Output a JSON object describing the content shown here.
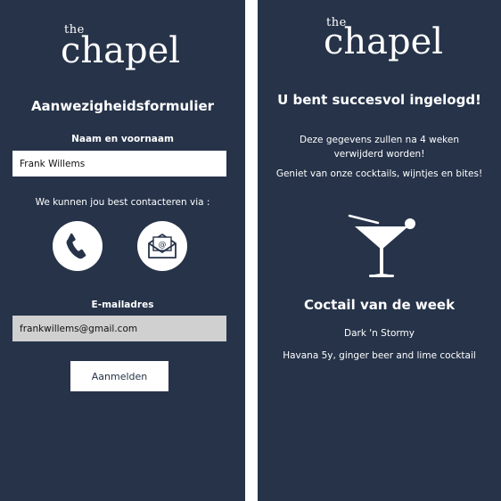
{
  "login_screen": {
    "logo": {
      "small": "the",
      "main": "chapel"
    },
    "title": "Aanwezigheidsformulier",
    "name_label": "Naam en voornaam",
    "name_value": "Frank Willems",
    "contact_prompt": "We kunnen jou best contacteren via :",
    "contact_options": [
      {
        "icon": "phone-icon"
      },
      {
        "icon": "envelope-at-icon"
      }
    ],
    "email_label": "E-mailadres",
    "email_value": "frankwillems@gmail.com",
    "submit_label": "Aanmelden"
  },
  "success_screen": {
    "logo": {
      "small": "the",
      "main": "chapel"
    },
    "title": "U bent succesvol ingelogd!",
    "retention_notice": "Deze gegevens zullen na 4 weken verwijderd worden!",
    "enjoy_text": "Geniet van onze cocktails, wijntjes en bites!",
    "cocktail_icon": "cocktail-glass-icon",
    "cocktail_heading": "Coctail van de week",
    "cocktail_name": "Dark 'n Stormy",
    "cocktail_description": "Havana 5y, ginger beer and lime cocktail"
  },
  "colors": {
    "panel_background": "#263349",
    "divider": "#ffffff",
    "text": "#ffffff",
    "email_field_background": "#d0d0d0"
  }
}
